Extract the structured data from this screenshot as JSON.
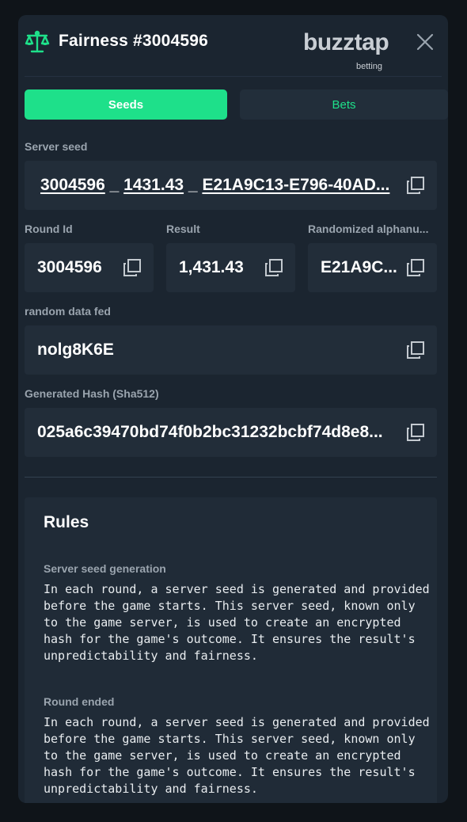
{
  "header": {
    "title": "Fairness #3004596",
    "logo_main": "buzztap",
    "logo_sub": "betting"
  },
  "tabs": [
    {
      "label": "Seeds",
      "active": true
    },
    {
      "label": "Bets",
      "active": false
    }
  ],
  "server_seed": {
    "label": "Server seed",
    "parts": [
      "3004596",
      "1431.43",
      "E21A9C13-E796-40AD..."
    ],
    "separator": "_"
  },
  "round_id": {
    "label": "Round Id",
    "value": "3004596"
  },
  "result": {
    "label": "Result",
    "value": "1,431.43"
  },
  "randomized": {
    "label": "Randomized alphanu...",
    "value": "E21A9C..."
  },
  "random_data": {
    "label": "random data fed",
    "value": "nolg8K6E"
  },
  "generated_hash": {
    "label": "Generated Hash (Sha512)",
    "value": "025a6c39470bd74f0b2bc31232bcbf74d8e8..."
  },
  "rules": {
    "title": "Rules",
    "sections": [
      {
        "heading": "Server seed generation",
        "text": "In each round, a server seed is generated and provided before the game starts. This server seed, known only to the game server, is used to create an encrypted hash for the game's outcome. It ensures the result's unpredictability and fairness."
      },
      {
        "heading": "Round ended",
        "text": "In each round, a server seed is generated and provided before the game starts. This server seed, known only to the game server, is used to create an encrypted hash for the game's outcome. It ensures the result's unpredictability and fairness."
      }
    ]
  },
  "colors": {
    "accent": "#1ee08a",
    "modal_bg": "#1b2530",
    "field_bg": "#222d39"
  },
  "icons": [
    "scale-icon",
    "close-icon",
    "copy-icon"
  ]
}
